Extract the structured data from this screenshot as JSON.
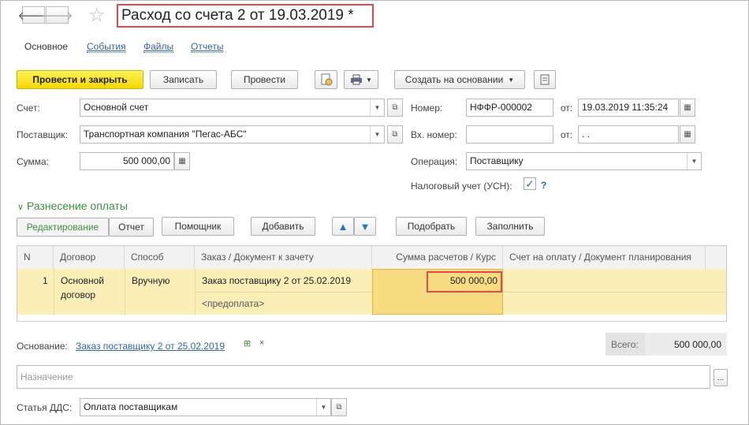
{
  "window": {
    "title": "Расход со счета 2 от 19.03.2019 *"
  },
  "nav": {
    "back_icon": "arrow-left-icon",
    "forward_icon": "arrow-right-icon",
    "favorite_icon": "star-icon"
  },
  "tabs": [
    {
      "label": "Основное",
      "active": true
    },
    {
      "label": "События",
      "active": false
    },
    {
      "label": "Файлы",
      "active": false
    },
    {
      "label": "Отчеты",
      "active": false
    }
  ],
  "toolbar": {
    "post_close": "Провести и закрыть",
    "save": "Записать",
    "post": "Провести",
    "create_based": "Создать на основании"
  },
  "form": {
    "account_label": "Счет:",
    "account_value": "Основной счет",
    "supplier_label": "Поставщик:",
    "supplier_value": "Транспортная компания \"Пегас-АБС\"",
    "sum_label": "Сумма:",
    "sum_value": "500 000,00",
    "number_label": "Номер:",
    "number_value": "НФФР-000002",
    "from_label": "от:",
    "date_value": "19.03.2019 11:35:24",
    "in_number_label": "Вх. номер:",
    "in_number_value": "",
    "from2_label": "от:",
    "in_date_value": " .  .",
    "operation_label": "Операция:",
    "operation_value": "Поставщику",
    "tax_label": "Налоговый учет (УСН):",
    "tax_checked": true,
    "help": "?"
  },
  "allocation": {
    "title": "Разнесение оплаты",
    "toggle_edit": "Редактирование",
    "toggle_report": "Отчет",
    "helper": "Помощник",
    "add": "Добавить",
    "pick": "Подобрать",
    "fill": "Заполнить"
  },
  "table": {
    "columns": [
      "N",
      "Договор",
      "Способ",
      "Заказ / Документ к зачету",
      "Сумма расчетов / Курс",
      "Счет на оплату / Документ планирования"
    ],
    "rows": [
      {
        "n": "1",
        "contract_line1": "Основной",
        "contract_line2": "договор",
        "method": "Вручную",
        "order": "Заказ поставщику 2 от 25.02.2019",
        "order_sub": "<предоплата>",
        "amount": "500 000,00",
        "invoice": ""
      }
    ]
  },
  "footer": {
    "basis_label": "Основание:",
    "basis_link": "Заказ поставщику 2 от 25.02.2019",
    "total_label": "Всего:",
    "total_value": "500 000,00",
    "purpose_placeholder": "Назначение",
    "dds_label": "Статья ДДС:",
    "dds_value": "Оплата поставщикам"
  }
}
